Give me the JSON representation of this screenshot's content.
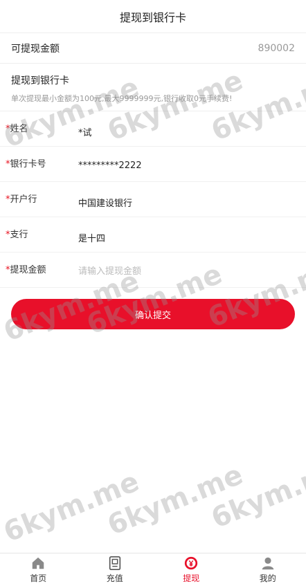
{
  "header": {
    "title": "提现到银行卡"
  },
  "balance": {
    "label": "可提现金额",
    "value": "890002"
  },
  "card_info": {
    "title": "提现到银行卡",
    "note": "单次提现最小金额为100元,最大9999999元,银行收取0元手续费!"
  },
  "form": {
    "name": {
      "label": "姓名",
      "value": "*试"
    },
    "card_number": {
      "label": "银行卡号",
      "value": "*********2222"
    },
    "bank": {
      "label": "开户行",
      "value": "中国建设银行"
    },
    "branch": {
      "label": "支行",
      "value": "是十四"
    },
    "amount": {
      "label": "提现金额",
      "placeholder": "请输入提现金额"
    }
  },
  "submit_label": "确认提交",
  "watermark_text": "6kym.me",
  "tabbar": {
    "items": [
      {
        "label": "首页",
        "icon": "home-icon"
      },
      {
        "label": "充值",
        "icon": "recharge-icon"
      },
      {
        "label": "提现",
        "icon": "withdraw-icon",
        "active": true
      },
      {
        "label": "我的",
        "icon": "user-icon"
      }
    ]
  },
  "colors": {
    "accent": "#e8102a",
    "required_star": "#e8101e"
  }
}
